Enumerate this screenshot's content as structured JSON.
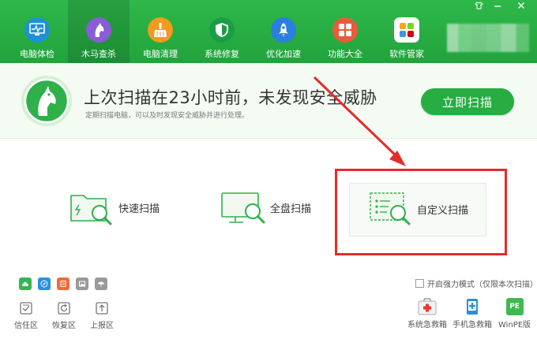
{
  "window": {
    "controls": [
      {
        "name": "shirt-icon"
      },
      {
        "name": "minimize-icon"
      },
      {
        "name": "close-icon"
      }
    ]
  },
  "nav": {
    "items": [
      {
        "label": "电脑体检",
        "icon": "monitor-pulse-icon",
        "color": "#1e90d6"
      },
      {
        "label": "木马查杀",
        "icon": "horse-icon",
        "color": "#8a5cd6",
        "active": true
      },
      {
        "label": "电脑清理",
        "icon": "broom-icon",
        "color": "#f39a1f"
      },
      {
        "label": "系统修复",
        "icon": "shield-icon",
        "color": "#1a9e45"
      },
      {
        "label": "优化加速",
        "icon": "rocket-icon",
        "color": "#2a7fe0"
      },
      {
        "label": "功能大全",
        "icon": "grid-icon",
        "color": "#ea5b3b"
      },
      {
        "label": "软件管家",
        "icon": "apps-icon",
        "color": "#ffffff"
      }
    ]
  },
  "status": {
    "title": "上次扫描在23小时前，未发现安全威胁",
    "subtitle": "定期扫描电脑，可以及时发现安全威胁并进行处理。",
    "scan_button": "立即扫描"
  },
  "scan_options": [
    {
      "label": "快速扫描",
      "icon": "folder-search-icon"
    },
    {
      "label": "全盘扫描",
      "icon": "monitor-search-icon"
    },
    {
      "label": "自定义扫描",
      "icon": "list-search-icon",
      "highlighted": true
    }
  ],
  "mini_tools": [
    {
      "icon": "cloud-icon",
      "color": "#36b552"
    },
    {
      "icon": "compass-icon",
      "color": "#2a8fe0"
    },
    {
      "icon": "document-icon",
      "color": "#ef6a3a"
    },
    {
      "icon": "image-icon",
      "color": "#9a9a9a"
    },
    {
      "icon": "umbrella-icon",
      "color": "#9a9a9a"
    }
  ],
  "bottom_tools": [
    {
      "label": "信任区",
      "icon": "trust-zone-icon"
    },
    {
      "label": "恢复区",
      "icon": "restore-zone-icon"
    },
    {
      "label": "上报区",
      "icon": "upload-zone-icon"
    }
  ],
  "strong_mode": {
    "label": "开启强力模式（仅限本次扫描）",
    "checked": false
  },
  "rescue_tools": [
    {
      "label": "系统急救箱",
      "icon": "first-aid-kit-icon"
    },
    {
      "label": "手机急救箱",
      "icon": "phone-rescue-icon"
    },
    {
      "label": "WinPE版",
      "icon": "pe-icon",
      "badge": "PE"
    }
  ],
  "colors": {
    "brand_green": "#28ad43",
    "highlight_red": "#e52b2b"
  }
}
